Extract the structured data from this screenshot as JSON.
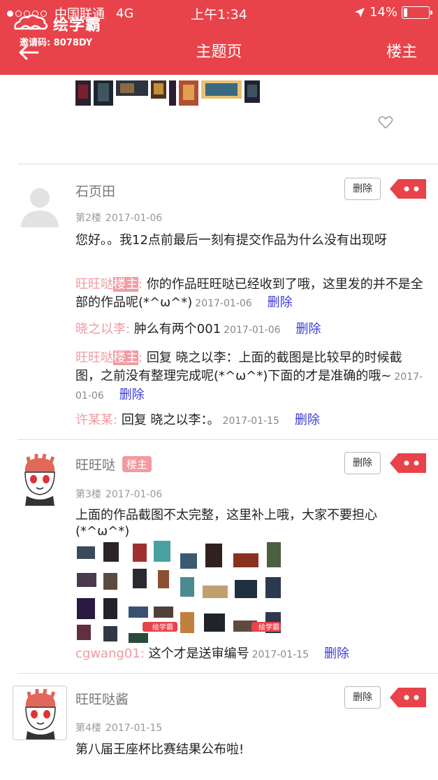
{
  "status_bar": {
    "carrier": "中国联通",
    "network": "4G",
    "time": "上午1:34",
    "battery": "14%"
  },
  "app": {
    "logo_text": "绘学霸",
    "invite_code": "邀请码: 8078DY"
  },
  "nav": {
    "title": "主题页",
    "right_label": "楼主"
  },
  "delete_label": "删除",
  "owner_badge": "楼主",
  "posts": [
    {
      "username": "石页田",
      "floor": "第2楼",
      "date": "2017-01-06",
      "text": "您好。。我12点前最后一刻有提交作品为什么没有出现呀",
      "replies": [
        {
          "name": "旺旺哒",
          "owner": "楼主",
          "colon": ":",
          "text": "你的作品旺旺哒已经收到了哦，这里发的并不是全部的作品呢(*^ω^*)",
          "date": "2017-01-06",
          "delete": "删除"
        },
        {
          "name": "晓之以李",
          "colon": ":",
          "text": "肿么有两个001",
          "date": "2017-01-06",
          "delete": "删除"
        },
        {
          "name": "旺旺哒",
          "owner": "楼主",
          "colon": ":",
          "text": "回复 晓之以李：上面的截图是比较早的时候截图，之前没有整理完成呢(*^ω^*)下面的才是准确的哦~",
          "date": "2017-01-06",
          "delete": "删除"
        },
        {
          "name": "许某某",
          "colon": ":",
          "text": "回复 晓之以李：。",
          "date": "2017-01-15",
          "delete": "删除"
        }
      ]
    },
    {
      "username": "旺旺哒",
      "badge": "楼主",
      "floor": "第3楼",
      "date": "2017-01-06",
      "text": "上面的作品截图不太完整，这里补上哦，大家不要担心(*^ω^*)",
      "replies": [
        {
          "name": "cgwang01",
          "colon": ":",
          "text": "这个才是送审编号",
          "date": "2017-01-15",
          "delete": "删除"
        }
      ]
    },
    {
      "username": "旺旺哒酱",
      "floor": "第4楼",
      "date": "2017-01-15",
      "text": "第八届王座杯比赛结果公布啦!"
    }
  ],
  "image_watermark": "绘学霸",
  "colors": {
    "brand_red": "#e8434a",
    "reply_name": "#f19aa0",
    "delete_link": "#3c3cd8"
  }
}
